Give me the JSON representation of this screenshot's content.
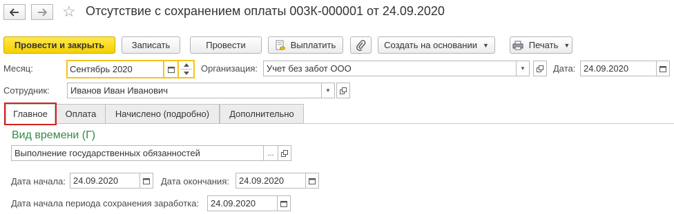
{
  "window": {
    "title": "Отсутствие с сохранением оплаты 003К-000001 от 24.09.2020",
    "back_icon": "arrow-left-icon",
    "forward_icon": "arrow-right-icon",
    "favorite_icon": "star-icon"
  },
  "toolbar": {
    "post_and_close": "Провести и закрыть",
    "save": "Записать",
    "post": "Провести",
    "pay": "Выплатить",
    "create_based_on": "Создать на основании",
    "print": "Печать"
  },
  "header": {
    "month_label": "Месяц:",
    "month_value": "Сентябрь 2020",
    "org_label": "Организация:",
    "org_value": "Учет без забот ООО",
    "date_label": "Дата:",
    "date_value": "24.09.2020",
    "employee_label": "Сотрудник:",
    "employee_value": "Иванов Иван Иванович"
  },
  "tabs": [
    {
      "label": "Главное",
      "active": true
    },
    {
      "label": "Оплата",
      "active": false
    },
    {
      "label": "Начислено (подробно)",
      "active": false
    },
    {
      "label": "Дополнительно",
      "active": false
    }
  ],
  "main": {
    "section_title": "Вид времени (Г)",
    "time_type_value": "Выполнение государственных обязанностей",
    "start_date_label": "Дата начала:",
    "start_date_value": "24.09.2020",
    "end_date_label": "Дата окончания:",
    "end_date_value": "24.09.2020",
    "earnings_start_label": "Дата начала периода сохранения заработка:",
    "earnings_start_value": "24.09.2020"
  },
  "colors": {
    "primary_button": "#f5d000",
    "section_title": "#2e8b45",
    "focus_border": "#f4c21a",
    "tab_highlight": "#d32020"
  }
}
